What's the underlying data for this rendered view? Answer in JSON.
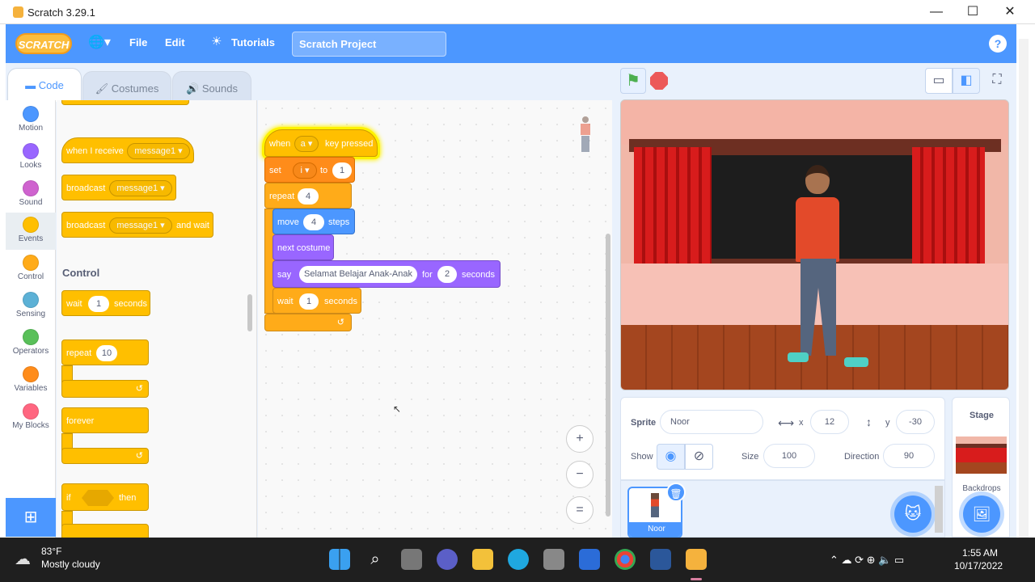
{
  "window": {
    "title": "Scratch 3.29.1",
    "minimize": "—",
    "maximize": "☐",
    "close": "✕"
  },
  "menubar": {
    "logo": "SCRATCH",
    "globe": "🌐▾",
    "file": "File",
    "edit": "Edit",
    "tutorials": "Tutorials",
    "project_title": "Scratch Project",
    "help": "?"
  },
  "tabs": {
    "code": "Code",
    "costumes": "Costumes",
    "sounds": "Sounds"
  },
  "categories": [
    {
      "label": "Motion",
      "color": "#4c97ff"
    },
    {
      "label": "Looks",
      "color": "#9966ff"
    },
    {
      "label": "Sound",
      "color": "#cf63cf"
    },
    {
      "label": "Events",
      "color": "#ffbf00"
    },
    {
      "label": "Control",
      "color": "#ffab19"
    },
    {
      "label": "Sensing",
      "color": "#5cb1d6"
    },
    {
      "label": "Operators",
      "color": "#59c059"
    },
    {
      "label": "Variables",
      "color": "#ff8c1a"
    },
    {
      "label": "My Blocks",
      "color": "#ff6680"
    }
  ],
  "palette": {
    "when_receive": "when I receive",
    "message1": "message1 ▾",
    "broadcast": "broadcast",
    "broadcast_and_wait": "and wait",
    "control_title": "Control",
    "wait": "wait",
    "wait_value": "1",
    "seconds": "seconds",
    "repeat": "repeat",
    "repeat_value": "10",
    "forever": "forever",
    "if": "if",
    "then": "then"
  },
  "script": {
    "when": "when",
    "key": "a ▾",
    "key_pressed": "key pressed",
    "set": "set",
    "var": "i ▾",
    "to": "to",
    "set_value": "1",
    "repeat": "repeat",
    "repeat_value": "4",
    "move": "move",
    "move_value": "4",
    "steps": "steps",
    "next_costume": "next costume",
    "say": "say",
    "say_text": "Selamat Belajar Anak-Anak",
    "for": "for",
    "say_secs": "2",
    "seconds": "seconds",
    "wait": "wait",
    "wait_value": "1",
    "wait_seconds": "seconds"
  },
  "zoom": {
    "in": "+",
    "out": "−",
    "reset": "="
  },
  "sprite_info": {
    "sprite_label": "Sprite",
    "sprite_name": "Noor",
    "x_label": "x",
    "x": "12",
    "y_label": "y",
    "y": "-30",
    "show_label": "Show",
    "size_label": "Size",
    "size": "100",
    "direction_label": "Direction",
    "direction": "90"
  },
  "sprites": [
    {
      "name": "Noor"
    }
  ],
  "stage_panel": {
    "title": "Stage",
    "backdrops": "Backdrops"
  },
  "taskbar": {
    "temp": "83°F",
    "weather": "Mostly cloudy",
    "time": "1:55 AM",
    "date": "10/17/2022"
  }
}
